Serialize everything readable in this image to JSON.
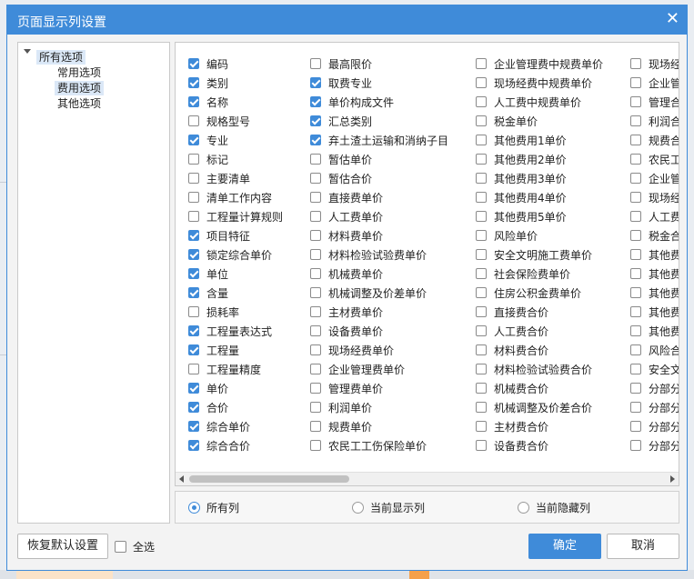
{
  "dialog": {
    "title": "页面显示列设置",
    "close_glyph": "✕"
  },
  "tree": [
    {
      "label": "所有选项",
      "level": 0,
      "selected": true
    },
    {
      "label": "常用选项",
      "level": 1,
      "selected": false
    },
    {
      "label": "费用选项",
      "level": 1,
      "selected": true
    },
    {
      "label": "其他选项",
      "level": 1,
      "selected": false
    }
  ],
  "columns": [
    [
      {
        "label": "编码",
        "checked": true
      },
      {
        "label": "类别",
        "checked": true
      },
      {
        "label": "名称",
        "checked": true
      },
      {
        "label": "规格型号",
        "checked": false
      },
      {
        "label": "专业",
        "checked": true
      },
      {
        "label": "标记",
        "checked": false
      },
      {
        "label": "主要清单",
        "checked": false
      },
      {
        "label": "清单工作内容",
        "checked": false
      },
      {
        "label": "工程量计算规则",
        "checked": false
      },
      {
        "label": "项目特征",
        "checked": true
      },
      {
        "label": "锁定综合单价",
        "checked": true
      },
      {
        "label": "单位",
        "checked": true
      },
      {
        "label": "含量",
        "checked": true
      },
      {
        "label": "损耗率",
        "checked": false
      },
      {
        "label": "工程量表达式",
        "checked": true
      },
      {
        "label": "工程量",
        "checked": true
      },
      {
        "label": "工程量精度",
        "checked": false
      },
      {
        "label": "单价",
        "checked": true
      },
      {
        "label": "合价",
        "checked": true
      },
      {
        "label": "综合单价",
        "checked": true
      },
      {
        "label": "综合合价",
        "checked": true
      }
    ],
    [
      {
        "label": "最高限价",
        "checked": false
      },
      {
        "label": "取费专业",
        "checked": true
      },
      {
        "label": "单价构成文件",
        "checked": true
      },
      {
        "label": "汇总类别",
        "checked": true
      },
      {
        "label": "弃土渣土运输和消纳子目",
        "checked": true
      },
      {
        "label": "暂估单价",
        "checked": false
      },
      {
        "label": "暂估合价",
        "checked": false
      },
      {
        "label": "直接费单价",
        "checked": false
      },
      {
        "label": "人工费单价",
        "checked": false
      },
      {
        "label": "材料费单价",
        "checked": false
      },
      {
        "label": "材料检验试验费单价",
        "checked": false
      },
      {
        "label": "机械费单价",
        "checked": false
      },
      {
        "label": "机械调整及价差单价",
        "checked": false
      },
      {
        "label": "主材费单价",
        "checked": false
      },
      {
        "label": "设备费单价",
        "checked": false
      },
      {
        "label": "现场经费单价",
        "checked": false
      },
      {
        "label": "企业管理费单价",
        "checked": false
      },
      {
        "label": "管理费单价",
        "checked": false
      },
      {
        "label": "利润单价",
        "checked": false
      },
      {
        "label": "规费单价",
        "checked": false
      },
      {
        "label": "农民工工伤保险单价",
        "checked": false
      }
    ],
    [
      {
        "label": "企业管理费中规费单价",
        "checked": false
      },
      {
        "label": "现场经费中规费单价",
        "checked": false
      },
      {
        "label": "人工费中规费单价",
        "checked": false
      },
      {
        "label": "税金单价",
        "checked": false
      },
      {
        "label": "其他费用1单价",
        "checked": false
      },
      {
        "label": "其他费用2单价",
        "checked": false
      },
      {
        "label": "其他费用3单价",
        "checked": false
      },
      {
        "label": "其他费用4单价",
        "checked": false
      },
      {
        "label": "其他费用5单价",
        "checked": false
      },
      {
        "label": "风险单价",
        "checked": false
      },
      {
        "label": "安全文明施工费单价",
        "checked": false
      },
      {
        "label": "社会保险费单价",
        "checked": false
      },
      {
        "label": "住房公积金费单价",
        "checked": false
      },
      {
        "label": "直接费合价",
        "checked": false
      },
      {
        "label": "人工费合价",
        "checked": false
      },
      {
        "label": "材料费合价",
        "checked": false
      },
      {
        "label": "材料检验试验费合价",
        "checked": false
      },
      {
        "label": "机械费合价",
        "checked": false
      },
      {
        "label": "机械调整及价差合价",
        "checked": false
      },
      {
        "label": "主材费合价",
        "checked": false
      },
      {
        "label": "设备费合价",
        "checked": false
      }
    ],
    [
      {
        "label": "现场经",
        "checked": false
      },
      {
        "label": "企业管",
        "checked": false
      },
      {
        "label": "管理合",
        "checked": false
      },
      {
        "label": "利润合",
        "checked": false
      },
      {
        "label": "规费合",
        "checked": false
      },
      {
        "label": "农民工",
        "checked": false
      },
      {
        "label": "企业管",
        "checked": false
      },
      {
        "label": "现场经",
        "checked": false
      },
      {
        "label": "人工费",
        "checked": false
      },
      {
        "label": "税金合",
        "checked": false
      },
      {
        "label": "其他费",
        "checked": false
      },
      {
        "label": "其他费",
        "checked": false
      },
      {
        "label": "其他费",
        "checked": false
      },
      {
        "label": "其他费",
        "checked": false
      },
      {
        "label": "其他费",
        "checked": false
      },
      {
        "label": "风险合",
        "checked": false
      },
      {
        "label": "安全文",
        "checked": false
      },
      {
        "label": "分部分",
        "checked": false
      },
      {
        "label": "分部分",
        "checked": false
      },
      {
        "label": "分部分",
        "checked": false
      },
      {
        "label": "分部分",
        "checked": false
      }
    ]
  ],
  "scope": [
    {
      "label": "所有列",
      "selected": true
    },
    {
      "label": "当前显示列",
      "selected": false
    },
    {
      "label": "当前隐藏列",
      "selected": false
    }
  ],
  "footer": {
    "restore_label": "恢复默认设置",
    "select_all_label": "全选",
    "select_all_checked": false,
    "ok_label": "确定",
    "cancel_label": "取消"
  },
  "colors": {
    "accent": "#3f8bd9"
  }
}
